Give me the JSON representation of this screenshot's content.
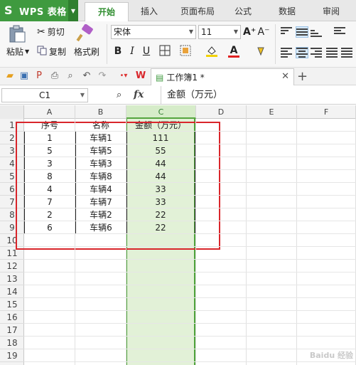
{
  "app": {
    "name": "WPS 表格",
    "logo": "S"
  },
  "menu": {
    "tabs": [
      "开始",
      "插入",
      "页面布局",
      "公式",
      "数据",
      "审阅"
    ],
    "active": "开始"
  },
  "ribbon": {
    "paste_label": "粘贴",
    "cut_label": "剪切",
    "copy_label": "复制",
    "format_painter_label": "格式刷",
    "font_name": "宋体",
    "font_size": "11",
    "bold": "B",
    "italic": "I",
    "underline": "U",
    "grow_font": "A⁺",
    "shrink_font": "A⁻",
    "font_color_letter": "A"
  },
  "document": {
    "tab_title": "工作簿1 *"
  },
  "formula_bar": {
    "name_box": "C1",
    "fx": "fx",
    "content": "金额（万元）"
  },
  "columns": [
    "A",
    "B",
    "C",
    "D",
    "E",
    "F"
  ],
  "rows": [
    "1",
    "2",
    "3",
    "4",
    "5",
    "6",
    "7",
    "8",
    "9",
    "10",
    "11",
    "12",
    "13",
    "14",
    "15",
    "16",
    "17",
    "18",
    "19"
  ],
  "table": {
    "headers": [
      "序号",
      "名称",
      "金额（万元）"
    ],
    "rows": [
      [
        "1",
        "车辆1",
        "111"
      ],
      [
        "5",
        "车辆5",
        "55"
      ],
      [
        "3",
        "车辆3",
        "44"
      ],
      [
        "8",
        "车辆8",
        "44"
      ],
      [
        "4",
        "车辆4",
        "33"
      ],
      [
        "7",
        "车辆7",
        "33"
      ],
      [
        "2",
        "车辆2",
        "22"
      ],
      [
        "6",
        "车辆6",
        "22"
      ]
    ]
  },
  "selection": {
    "column": "C"
  },
  "colors": {
    "brand": "#3f9a3f",
    "selection_fill": "#e2f1d7",
    "highlight_box": "#d9262b"
  },
  "watermark": "Baidu 经验"
}
